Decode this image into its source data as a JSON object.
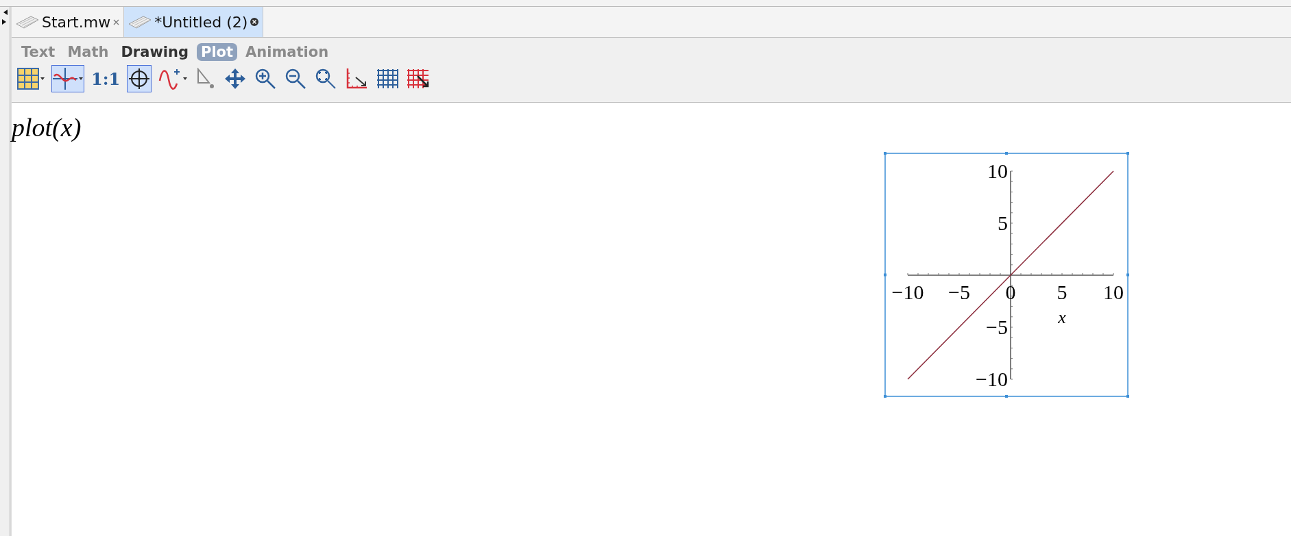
{
  "document_tabs": [
    {
      "label": "Start.mw",
      "selected": false
    },
    {
      "label": "*Untitled (2)",
      "selected": true
    }
  ],
  "context_tabs": [
    {
      "label": "Text",
      "selected": false,
      "disabled": true
    },
    {
      "label": "Math",
      "selected": false,
      "disabled": true
    },
    {
      "label": "Drawing",
      "selected": false,
      "disabled": false
    },
    {
      "label": "Plot",
      "selected": true,
      "disabled": false
    },
    {
      "label": "Animation",
      "selected": false,
      "disabled": true
    }
  ],
  "toolbar": [
    {
      "kind": "table",
      "selected": false,
      "dropdown": true
    },
    {
      "kind": "curve",
      "selected": true,
      "dropdown": true
    },
    {
      "kind": "label",
      "label": "1:1",
      "selected": false
    },
    {
      "kind": "crosshair",
      "selected": true
    },
    {
      "kind": "sine",
      "selected": false,
      "dropdown": true
    },
    {
      "kind": "pointer",
      "selected": false
    },
    {
      "kind": "move",
      "selected": false
    },
    {
      "kind": "zoomin",
      "selected": false
    },
    {
      "kind": "zoomout",
      "selected": false
    },
    {
      "kind": "zoomfit",
      "selected": false
    },
    {
      "kind": "axes",
      "selected": false
    },
    {
      "kind": "gridblue",
      "selected": false
    },
    {
      "kind": "gridred",
      "selected": false
    }
  ],
  "input": "plot(x)",
  "plot": {
    "chart_data": {
      "type": "line",
      "xlabel": "x",
      "x": [
        -10,
        10
      ],
      "series": [
        {
          "color": "#8b2a3a",
          "values": [
            -10,
            10
          ]
        }
      ],
      "xlim": [
        -10,
        10
      ],
      "ylim": [
        -10,
        10
      ],
      "xticks": [
        {
          "value": -10,
          "label": "−10"
        },
        {
          "value": -5,
          "label": "−5"
        },
        {
          "value": 0,
          "label": "0"
        },
        {
          "value": 5,
          "label": "5"
        },
        {
          "value": 10,
          "label": "10"
        }
      ],
      "yticks": [
        {
          "value": -10,
          "label": "−10"
        },
        {
          "value": -5,
          "label": "−5"
        },
        {
          "value": 5,
          "label": "5"
        },
        {
          "value": 10,
          "label": "10"
        }
      ]
    }
  }
}
